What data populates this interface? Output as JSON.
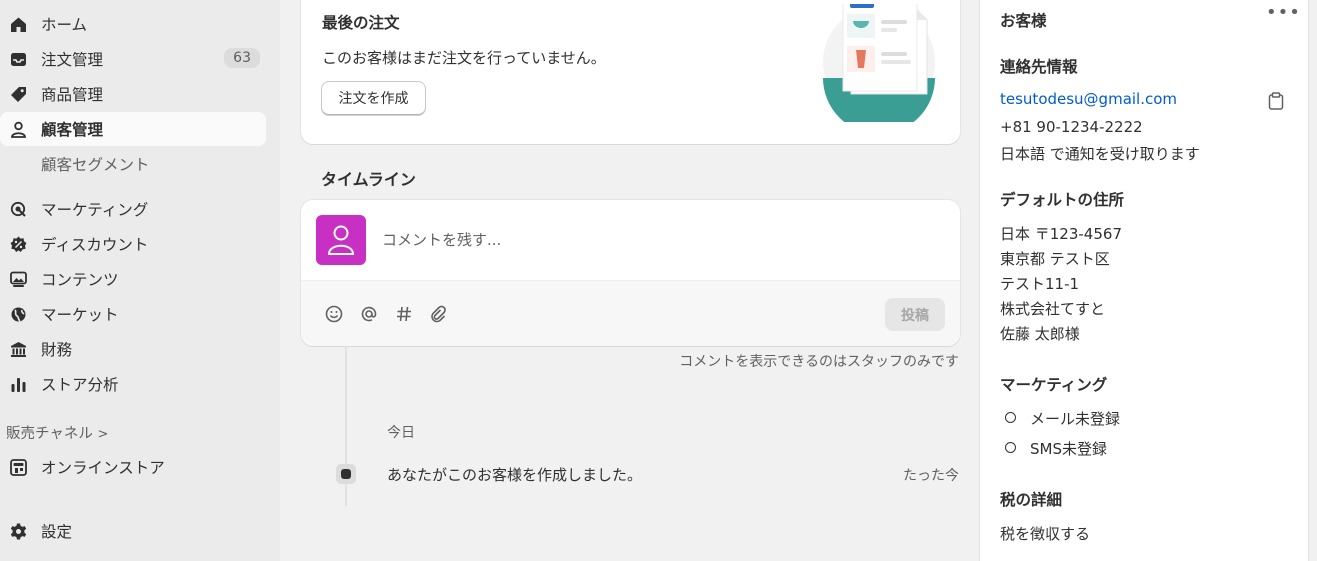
{
  "sidebar": {
    "items": [
      {
        "label": "ホーム",
        "icon": "home-icon"
      },
      {
        "label": "注文管理",
        "icon": "inbox-icon",
        "badge": "63"
      },
      {
        "label": "商品管理",
        "icon": "tag-icon"
      },
      {
        "label": "顧客管理",
        "icon": "person-icon",
        "active": true
      },
      {
        "label": "顧客セグメント"
      },
      {
        "label": "マーケティング",
        "icon": "target-icon"
      },
      {
        "label": "ディスカウント",
        "icon": "discount-icon"
      },
      {
        "label": "コンテンツ",
        "icon": "image-icon"
      },
      {
        "label": "マーケット",
        "icon": "globe-icon"
      },
      {
        "label": "財務",
        "icon": "bank-icon"
      },
      {
        "label": "ストア分析",
        "icon": "bar-chart-icon"
      }
    ],
    "sales_channels_label": "販売チャネル",
    "online_store": {
      "label": "オンラインストア",
      "icon": "store-icon"
    },
    "settings": {
      "label": "設定",
      "icon": "gear-icon"
    }
  },
  "last_order": {
    "title": "最後の注文",
    "description": "このお客様はまだ注文を行っていません。",
    "create_button": "注文を作成"
  },
  "timeline": {
    "title": "タイムライン",
    "comment_placeholder": "コメントを残す...",
    "post_button": "投稿",
    "staff_note": "コメントを表示できるのはスタッフのみです",
    "date_label": "今日",
    "events": [
      {
        "text": "あなたがこのお客様を作成しました。",
        "time": "たった今"
      }
    ]
  },
  "customer": {
    "title": "お客様",
    "contact_heading": "連絡先情報",
    "email": "tesutodesu@gmail.com",
    "phone": "+81 90-1234-2222",
    "notification_language": "日本語 で通知を受け取ります",
    "address_heading": "デフォルトの住所",
    "address_lines": [
      "日本 〒123-4567",
      "東京都 テスト区",
      "テスト11-1",
      "株式会社てすと",
      "佐藤 太郎様"
    ],
    "marketing_heading": "マーケティング",
    "marketing": [
      "メール未登録",
      "SMS未登録"
    ],
    "tax_heading": "税の詳細",
    "tax_status": "税を徴収する"
  },
  "colors": {
    "accent_link": "#005bd3",
    "avatar": "#c82fc3",
    "illustration_teal": "#3a9e94"
  }
}
